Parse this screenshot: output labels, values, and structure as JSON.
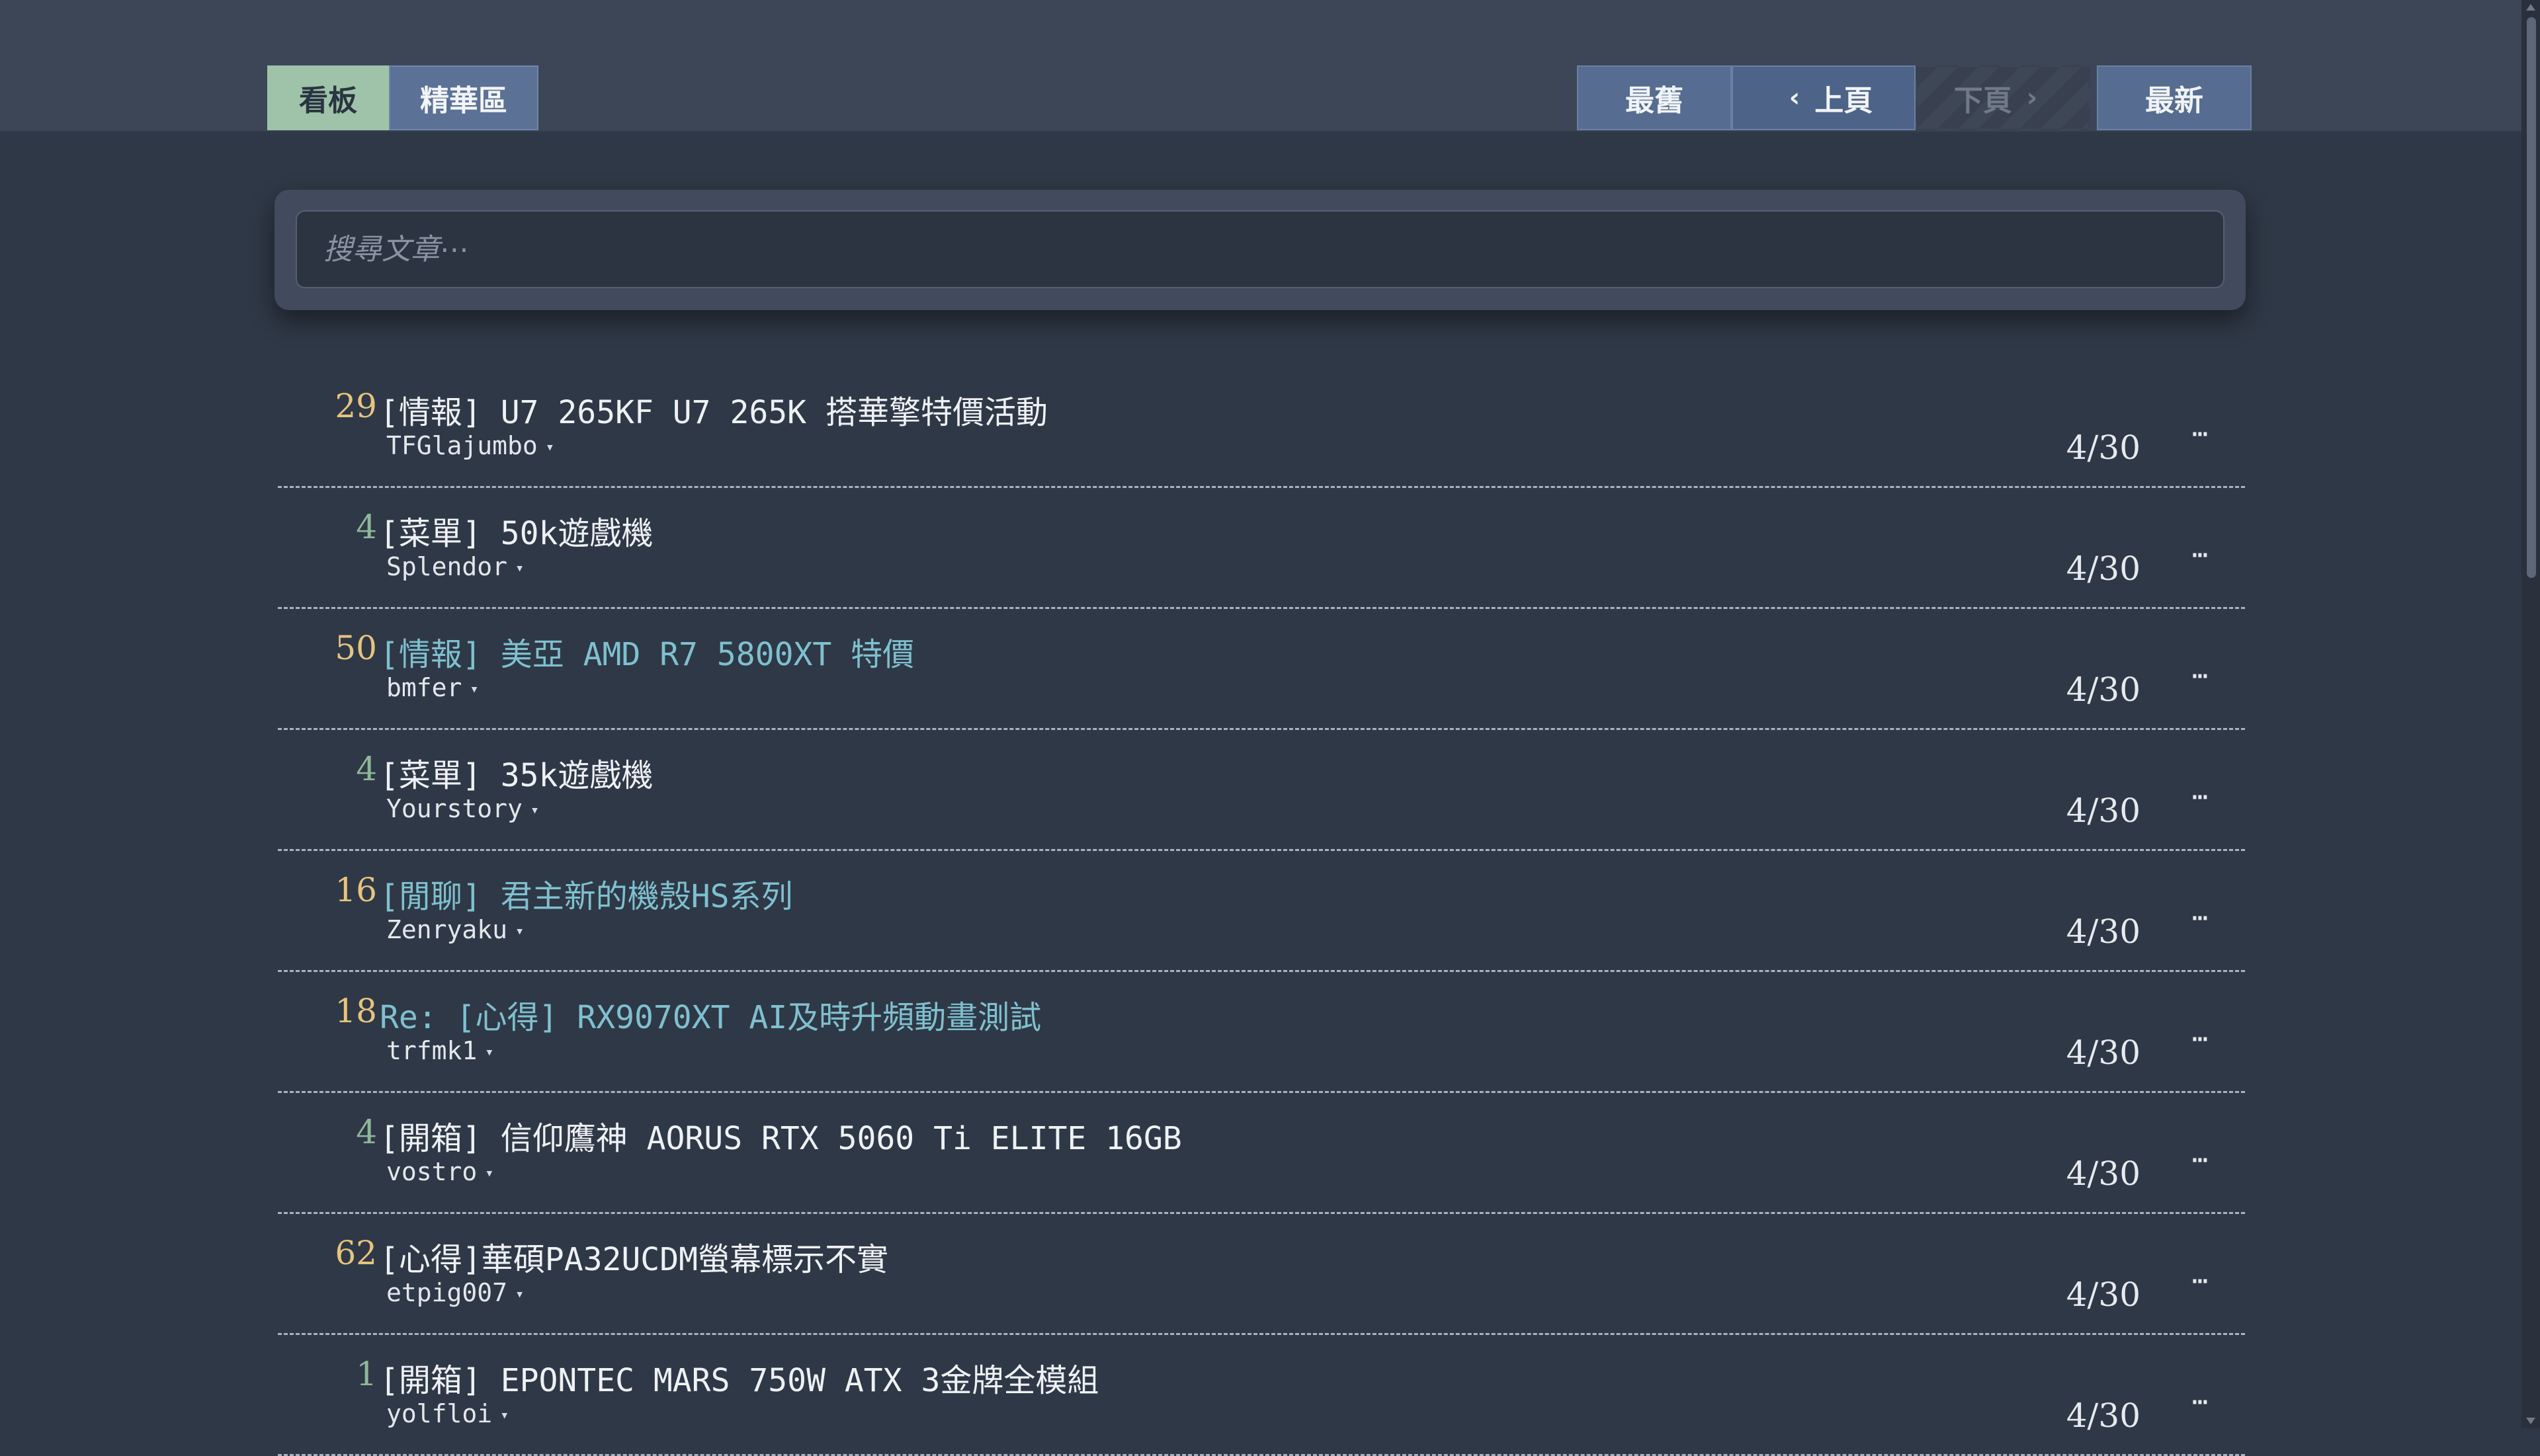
{
  "tabs": {
    "board_label": "看板",
    "digest_label": "精華區"
  },
  "pagination": {
    "oldest_label": "最舊",
    "prev_label": "上頁",
    "prev_icon": "‹",
    "next_label": "下頁",
    "next_icon": "›",
    "newest_label": "最新"
  },
  "search": {
    "placeholder": "搜尋文章⋯",
    "value": ""
  },
  "colors": {
    "count_high": "#e6c47e",
    "count_low": "#8fb79a",
    "title_visited": "#7fc0cf"
  },
  "posts": [
    {
      "count": "29",
      "count_color": "#e6c47e",
      "title": "[情報] U7 265KF U7 265K 搭華擎特價活動",
      "visited": false,
      "author": "TFGlajumbo",
      "date": "4/30"
    },
    {
      "count": "4",
      "count_color": "#8fb79a",
      "title": "[菜單] 50k遊戲機",
      "visited": false,
      "author": "Splendor",
      "date": "4/30"
    },
    {
      "count": "50",
      "count_color": "#e6c47e",
      "title": "[情報] 美亞 AMD R7 5800XT 特價",
      "visited": true,
      "author": "bmfer",
      "date": "4/30"
    },
    {
      "count": "4",
      "count_color": "#8fb79a",
      "title": "[菜單] 35k遊戲機",
      "visited": false,
      "author": "Yourstory",
      "date": "4/30"
    },
    {
      "count": "16",
      "count_color": "#e6c47e",
      "title": "[閒聊] 君主新的機殼HS系列",
      "visited": true,
      "author": "Zenryaku",
      "date": "4/30"
    },
    {
      "count": "18",
      "count_color": "#e6c47e",
      "title": "Re: [心得] RX9070XT AI及時升頻動畫測試",
      "visited": true,
      "author": "trfmk1",
      "date": "4/30"
    },
    {
      "count": "4",
      "count_color": "#8fb79a",
      "title": "[開箱] 信仰鷹神 AORUS RTX 5060 Ti ELITE 16GB",
      "visited": false,
      "author": "vostro",
      "date": "4/30"
    },
    {
      "count": "62",
      "count_color": "#e6c47e",
      "title": "[心得]華碩PA32UCDM螢幕標示不實",
      "visited": false,
      "author": "etpig007",
      "date": "4/30"
    },
    {
      "count": "1",
      "count_color": "#8fb79a",
      "title": "[開箱] EPONTEC MARS 750W ATX 3金牌全模組",
      "visited": false,
      "author": "yolfloi",
      "date": "4/30"
    }
  ],
  "row_menu_icon": "⋯",
  "author_menu_icon": "▾"
}
